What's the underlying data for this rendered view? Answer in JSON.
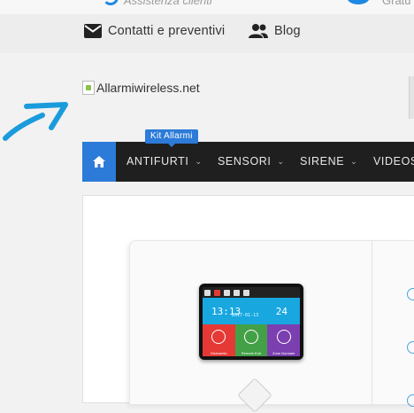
{
  "topbar": {
    "assistance_label": "Assistenza clienti",
    "right_label": "Gratu"
  },
  "links": {
    "contact_label": "Contatti e preventivi",
    "blog_label": "Blog"
  },
  "logo": {
    "alt_text": "Allarmiwireless.net"
  },
  "nav": {
    "badge_label": "Kit Allarmi",
    "items": [
      {
        "label": "ANTIFURTI"
      },
      {
        "label": "SENSORI"
      },
      {
        "label": "SIRENE"
      },
      {
        "label": "VIDEOS"
      }
    ]
  },
  "product_screen": {
    "date": "2017-01-13",
    "time": "13:13",
    "temperature": "24",
    "tiles": [
      "Disinserito",
      "Remote Entr",
      "Zone Normale"
    ]
  },
  "colors": {
    "accent": "#2c7bd8",
    "nav_bg": "#1f1f1f",
    "arrow": "#1a9bdc"
  }
}
